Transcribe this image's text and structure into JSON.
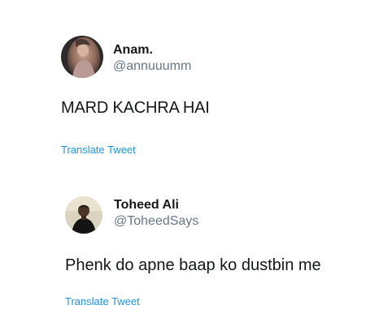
{
  "tweets": [
    {
      "display_name": "Anam.",
      "handle": "@annuuumm",
      "text": "MARD KACHRA HAI",
      "translate_label": "Translate Tweet"
    },
    {
      "display_name": "Toheed Ali",
      "handle": "@ToheedSays",
      "text": "Phenk do apne baap ko dustbin me",
      "translate_label": "Translate Tweet"
    }
  ],
  "colors": {
    "text_primary": "#14171a",
    "text_secondary": "#657786",
    "link": "#1b95e0",
    "background": "#ffffff"
  }
}
